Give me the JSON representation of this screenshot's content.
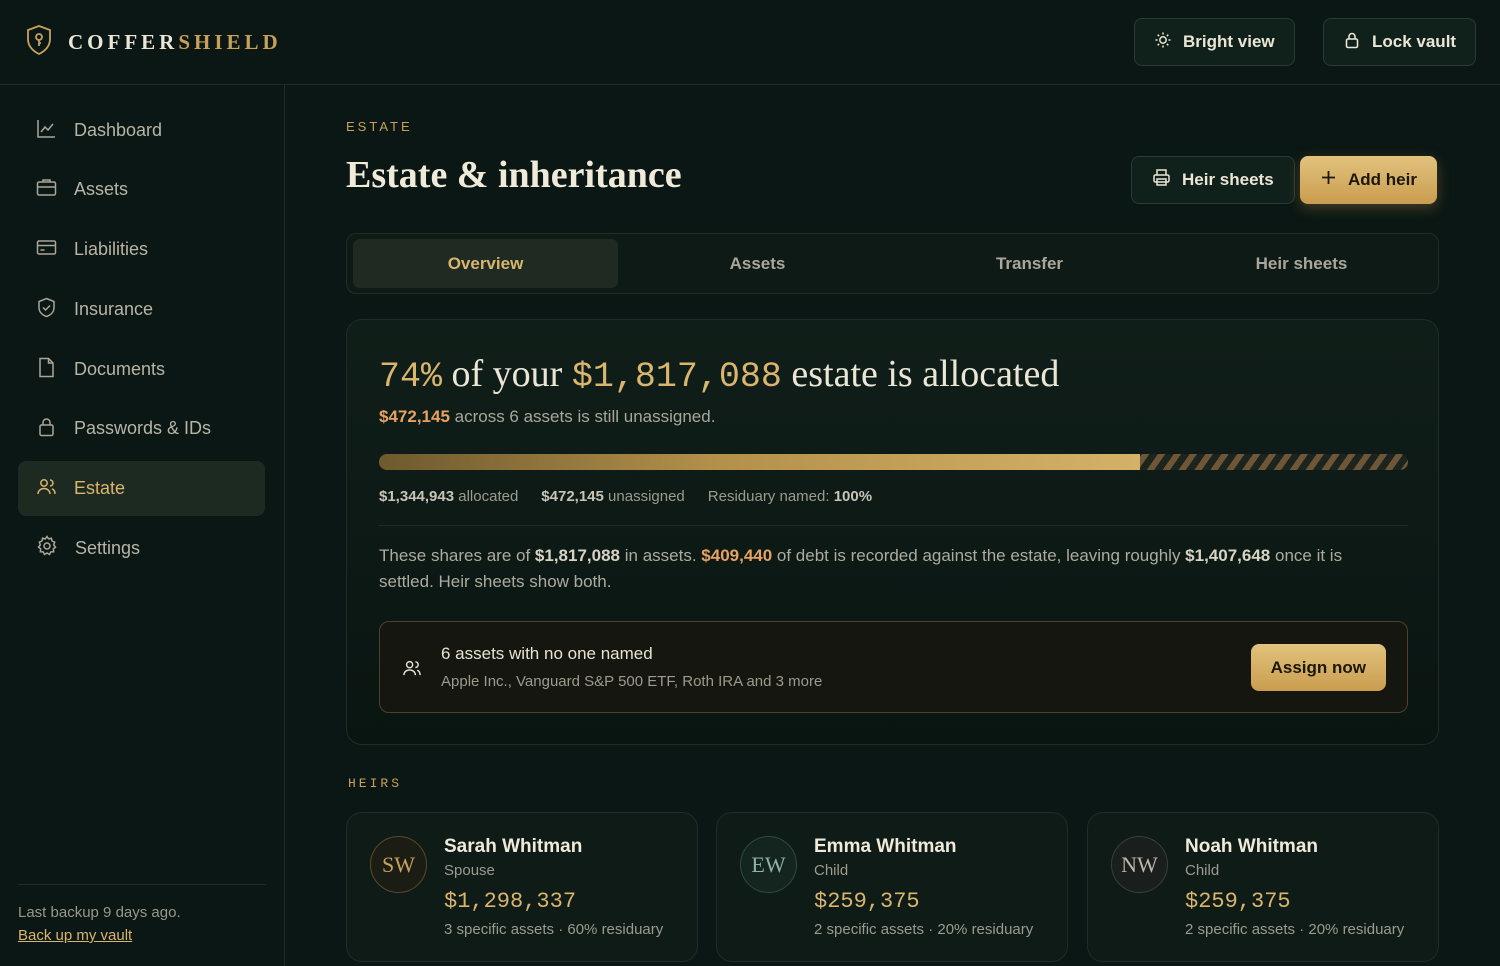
{
  "brand": {
    "part1": "COFFER",
    "part2": "SHIELD"
  },
  "topbar": {
    "bright_view": "Bright view",
    "lock_vault": "Lock vault"
  },
  "sidebar": {
    "items": [
      {
        "label": "Dashboard",
        "icon": "chart-icon"
      },
      {
        "label": "Assets",
        "icon": "briefcase-icon"
      },
      {
        "label": "Liabilities",
        "icon": "card-icon"
      },
      {
        "label": "Insurance",
        "icon": "shield-check-icon"
      },
      {
        "label": "Documents",
        "icon": "document-icon"
      },
      {
        "label": "Passwords & IDs",
        "icon": "lock-icon"
      },
      {
        "label": "Estate",
        "icon": "people-icon",
        "active": true
      },
      {
        "label": "Settings",
        "icon": "gear-icon"
      }
    ],
    "footer_note": "Last backup 9 days ago.",
    "footer_link": "Back up my vault"
  },
  "page": {
    "eyebrow": "ESTATE",
    "title": "Estate & inheritance",
    "heir_sheets_button": "Heir sheets",
    "add_heir_button": "Add heir"
  },
  "tabs": [
    "Overview",
    "Assets",
    "Transfer",
    "Heir sheets"
  ],
  "active_tab": "Overview",
  "allocation": {
    "pct": "74%",
    "of_your": " of your ",
    "total": "$1,817,088",
    "tail": " estate is allocated",
    "unassigned_amount": "$472,145",
    "unassigned_text": " across 6 assets is still unassigned.",
    "allocated_fraction": 0.74,
    "allocated_amount": "$1,344,943",
    "allocated_label": " allocated",
    "unassigned_label": " unassigned",
    "residuary_label": "Residuary named: ",
    "residuary_value": "100%",
    "para_1": "These shares are of ",
    "para_total": "$1,817,088",
    "para_2": " in assets. ",
    "para_debt": "$409,440",
    "para_3": " of debt is recorded against the estate, leaving roughly ",
    "para_net": "$1,407,648",
    "para_4": " once it is settled. Heir sheets show both."
  },
  "alert": {
    "title": "6 assets with no one named",
    "detail": "Apple Inc., Vanguard S&P 500 ETF, Roth IRA and 3 more",
    "button": "Assign now"
  },
  "heirs_label": "HEIRS",
  "heirs": [
    {
      "initials": "SW",
      "name": "Sarah Whitman",
      "role": "Spouse",
      "amount": "$1,298,337",
      "meta": "3 specific assets · 60% residuary",
      "color": "#c9a05a"
    },
    {
      "initials": "EW",
      "name": "Emma Whitman",
      "role": "Child",
      "amount": "$259,375",
      "meta": "2 specific assets · 20% residuary",
      "color": "#8fb3a0"
    },
    {
      "initials": "NW",
      "name": "Noah Whitman",
      "role": "Child",
      "amount": "$259,375",
      "meta": "2 specific assets · 20% residuary",
      "color": "#bdb7a8"
    }
  ]
}
